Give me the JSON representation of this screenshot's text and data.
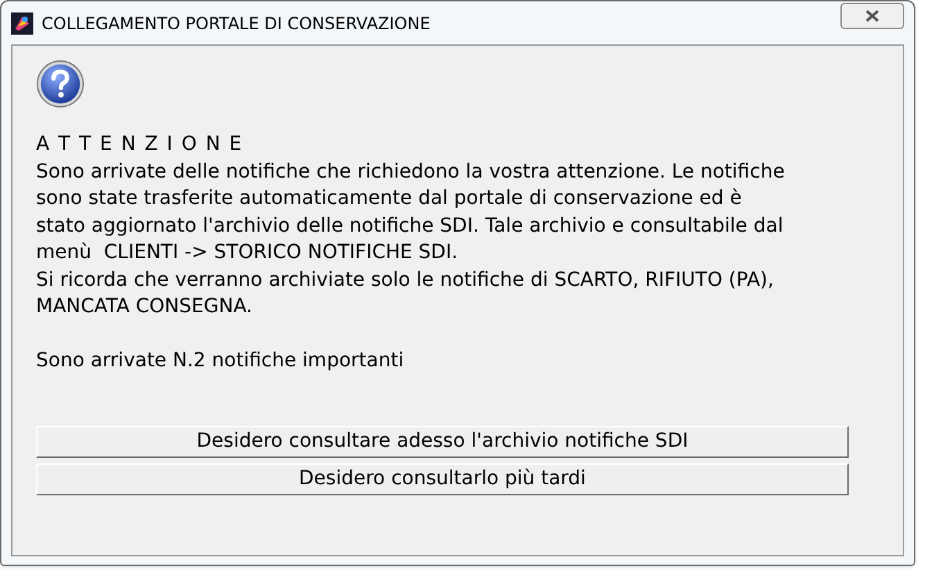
{
  "window": {
    "title": "COLLEGAMENTO PORTALE DI CONSERVAZIONE"
  },
  "heading": "A T T E N Z I O N E",
  "message_lines": [
    "Sono arrivate delle notifiche che richiedono la vostra attenzione. Le notifiche",
    "sono state trasferite automaticamente dal portale di conservazione ed è",
    "stato aggiornato l'archivio delle notifiche SDI. Tale archivio e consultabile dal",
    "menù  CLIENTI -> STORICO NOTIFICHE SDI.",
    "Si ricorda che verranno archiviate solo le notifiche di SCARTO, RIFIUTO (PA),",
    "MANCATA CONSEGNA."
  ],
  "count_message": "Sono arrivate N.2 notifiche importanti",
  "buttons": [
    "Desidero consultare adesso l'archivio notifiche SDI",
    "Desidero consultarlo più tardi"
  ]
}
